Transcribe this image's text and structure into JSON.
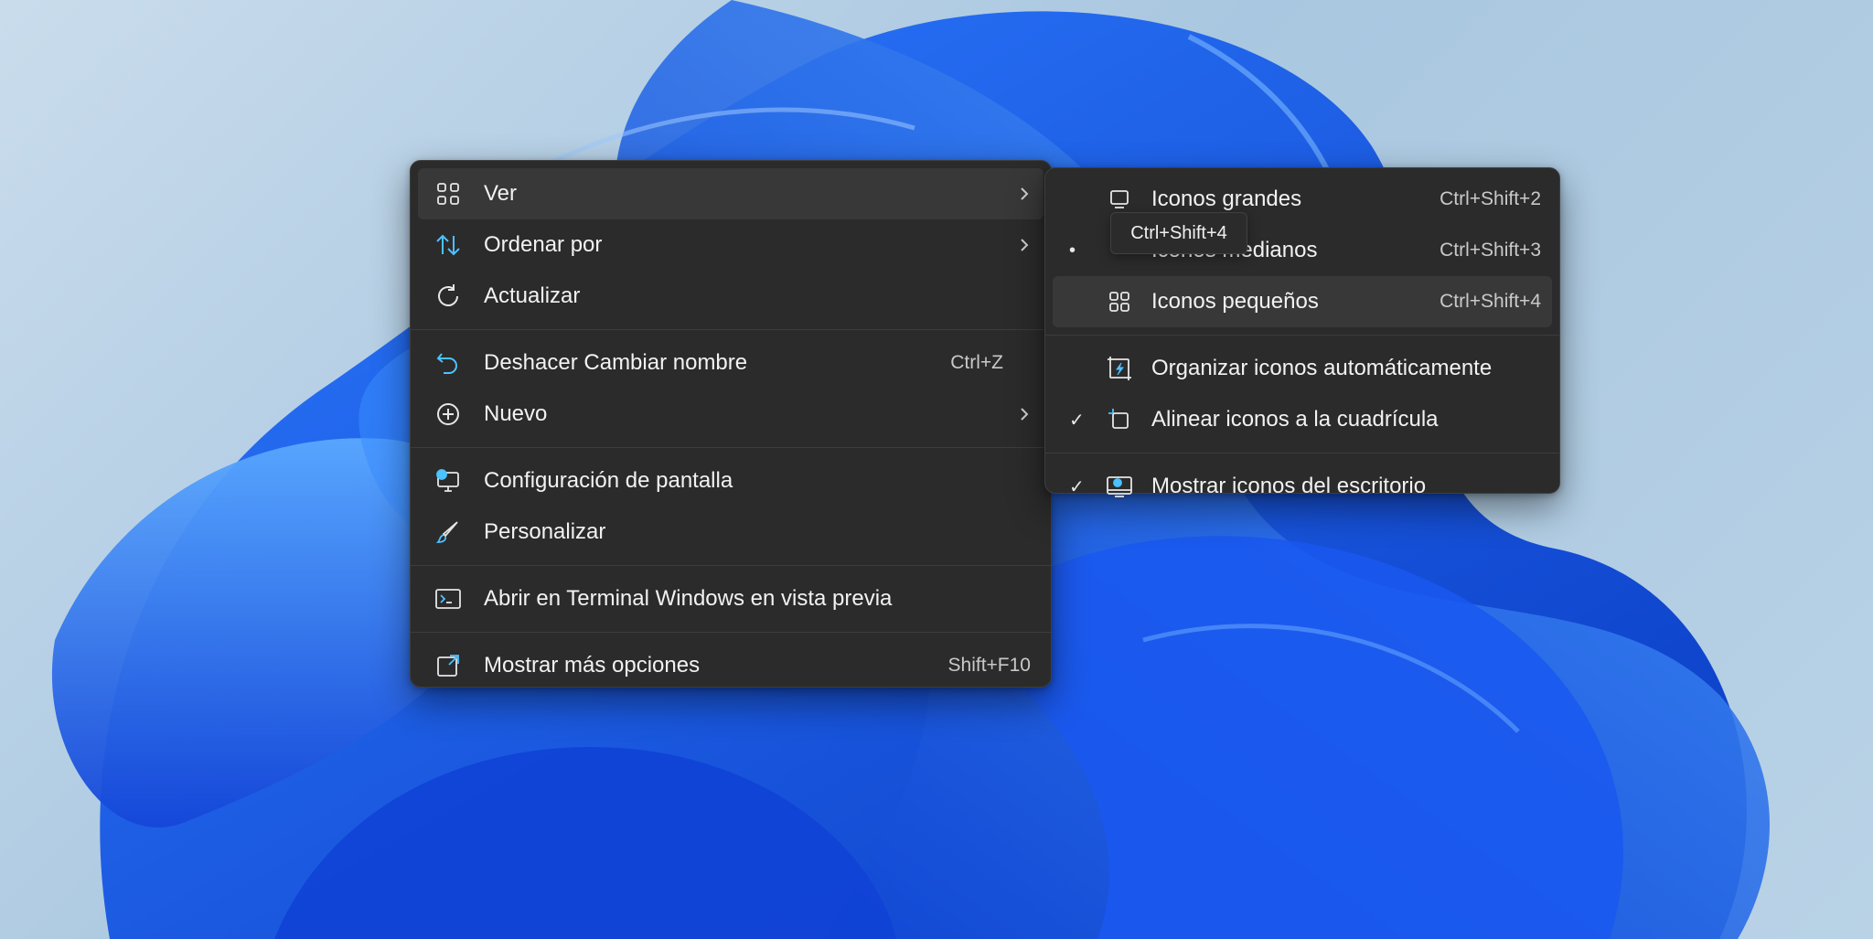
{
  "colors": {
    "menu_bg": "#2b2b2b",
    "hover_bg": "#383838",
    "text": "#f2f2f2",
    "accent": "#4cc2ff",
    "wallpaper_blue": "#1f5fe8"
  },
  "main_menu": {
    "items": [
      {
        "label": "Ver",
        "icon": "grid-view-icon",
        "has_submenu": true
      },
      {
        "label": "Ordenar por",
        "icon": "sort-arrows-icon",
        "has_submenu": true
      },
      {
        "label": "Actualizar",
        "icon": "refresh-icon"
      },
      {
        "label": "Deshacer Cambiar nombre",
        "icon": "undo-icon",
        "shortcut": "Ctrl+Z"
      },
      {
        "label": "Nuevo",
        "icon": "plus-circle-icon",
        "has_submenu": true
      },
      {
        "label": "Configuración de pantalla",
        "icon": "display-settings-icon"
      },
      {
        "label": "Personalizar",
        "icon": "paintbrush-icon"
      },
      {
        "label": "Abrir en Terminal Windows en vista previa",
        "icon": "terminal-icon"
      },
      {
        "label": "Mostrar más opciones",
        "icon": "more-options-icon",
        "shortcut": "Shift+F10"
      }
    ]
  },
  "sub_menu": {
    "items": [
      {
        "label": "Iconos grandes",
        "icon": "monitor-icon",
        "shortcut": "Ctrl+Shift+2"
      },
      {
        "label": "Iconos medianos",
        "icon": "",
        "shortcut": "Ctrl+Shift+3",
        "mark": "•"
      },
      {
        "label": "Iconos pequeños",
        "icon": "small-grid-icon",
        "shortcut": "Ctrl+Shift+4"
      },
      {
        "label": "Organizar iconos automáticamente",
        "icon": "auto-arrange-icon"
      },
      {
        "label": "Alinear iconos a la cuadrícula",
        "icon": "align-grid-icon",
        "mark": "✓"
      },
      {
        "label": "Mostrar iconos del escritorio",
        "icon": "desktop-icons-icon",
        "mark": "✓"
      }
    ]
  },
  "tooltip": {
    "text": "Ctrl+Shift+4"
  }
}
